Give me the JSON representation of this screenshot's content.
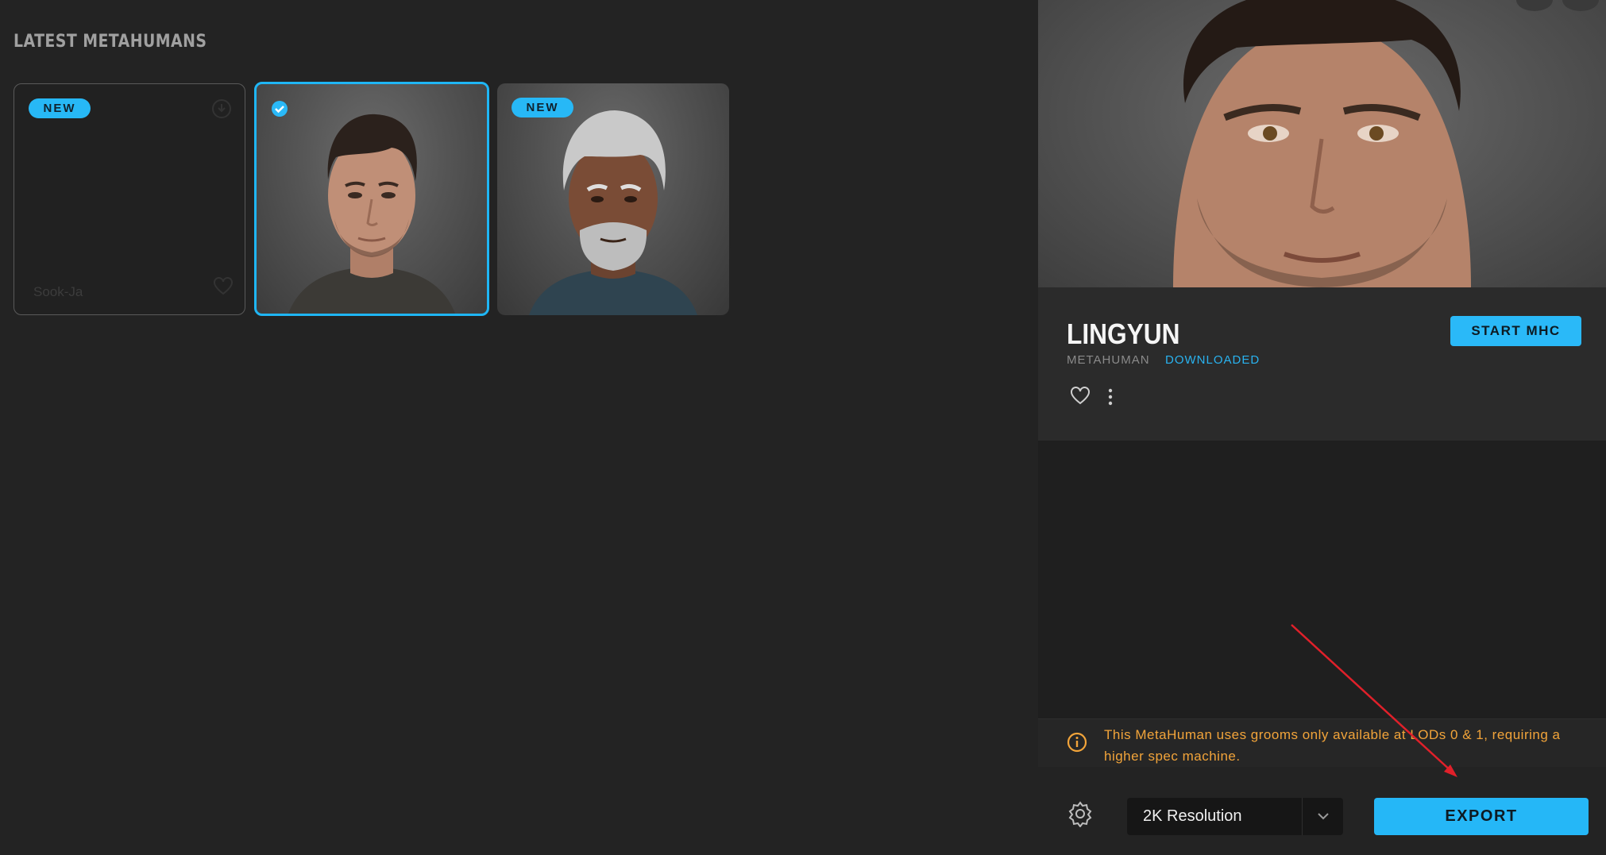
{
  "section_title": "LATEST METAHUMANS",
  "cards": [
    {
      "badge": "NEW",
      "name": "Sook-Ja",
      "selected": false
    },
    {
      "badge": "",
      "name": "",
      "selected": true
    },
    {
      "badge": "NEW",
      "name": "",
      "selected": false
    }
  ],
  "detail": {
    "name": "LINGYUN",
    "type": "METAHUMAN",
    "status": "DOWNLOADED",
    "start_button": "START MHC",
    "warning": "This MetaHuman uses grooms only available at LODs 0 & 1, requiring a higher spec machine.",
    "resolution": "2K Resolution",
    "export_button": "EXPORT"
  },
  "colors": {
    "accent": "#25b7f7",
    "warning": "#f2a43a",
    "annotation_arrow": "#e0202a"
  }
}
